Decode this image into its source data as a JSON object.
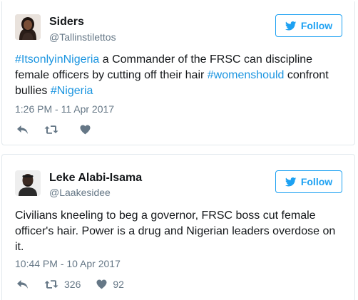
{
  "tweets": [
    {
      "name": "Siders",
      "handle": "@Tallinstilettos",
      "follow_label": "Follow",
      "text_parts": [
        {
          "type": "hashtag",
          "text": "#ItsonlyinNigeria"
        },
        {
          "type": "text",
          "text": " a Commander of the FRSC can discipline female officers by cutting off their hair "
        },
        {
          "type": "hashtag",
          "text": "#womenshould"
        },
        {
          "type": "text",
          "text": " confront bullies "
        },
        {
          "type": "hashtag",
          "text": "#Nigeria"
        }
      ],
      "timestamp": "1:26 PM - 11 Apr 2017",
      "retweet_count": "",
      "like_count": ""
    },
    {
      "name": "Leke Alabi-Isama",
      "handle": "@Laakesidee",
      "follow_label": "Follow",
      "text_parts": [
        {
          "type": "text",
          "text": "Civilians kneeling to beg a governor, FRSC boss cut female officer's hair. Power is a drug and Nigerian leaders overdose on it."
        }
      ],
      "timestamp": "10:44 PM - 10 Apr 2017",
      "retweet_count": "326",
      "like_count": "92"
    }
  ],
  "colors": {
    "accent": "#1da1f2",
    "hashtag": "#1b95e0",
    "muted": "#657786",
    "border": "#e1e8ed"
  },
  "icons": [
    "twitter-bird-icon",
    "reply-icon",
    "retweet-icon",
    "heart-icon"
  ]
}
